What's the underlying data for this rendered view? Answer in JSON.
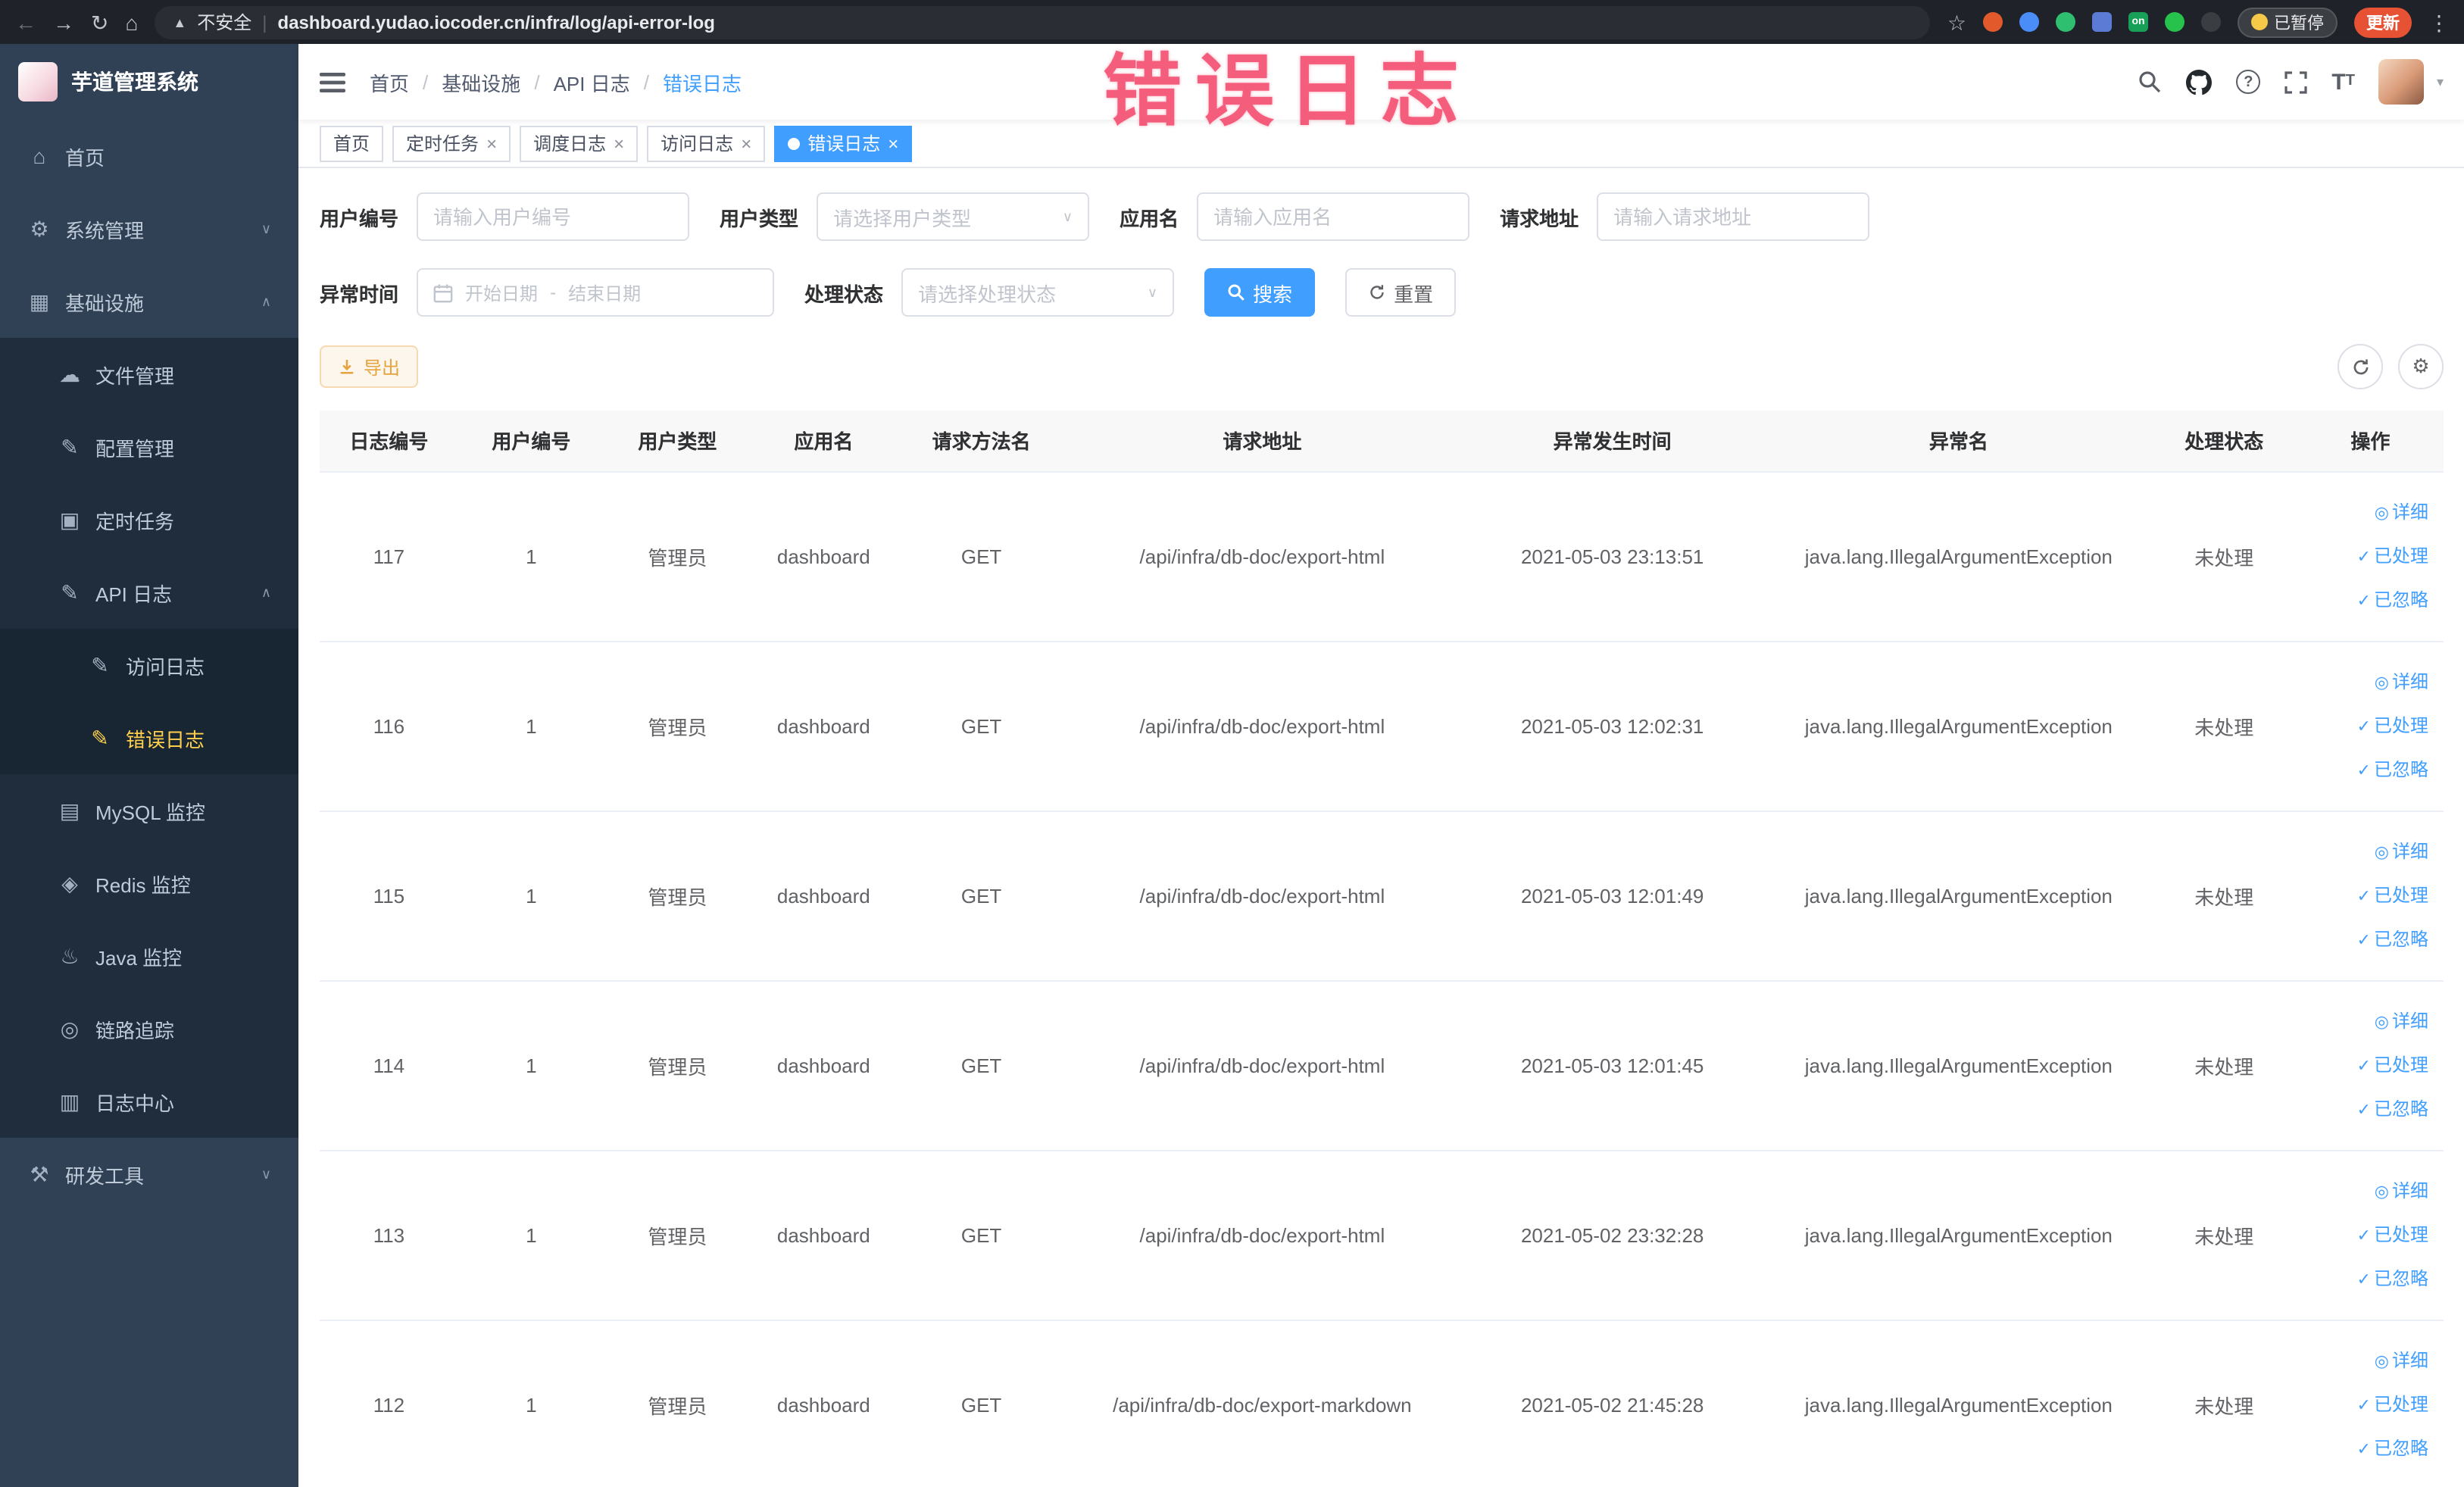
{
  "theme": {
    "accent": "#409eff",
    "sidebar_bg": "#304156",
    "sidebar_sub_bg": "#1f2d3d",
    "sidebar_active_text": "#ffd04b",
    "export_warning": "#e6a23c",
    "active_tag_bg": "#409eff",
    "annotation_color": "#f4476b",
    "update_button_color": "#e65233"
  },
  "browser": {
    "security_label": "不安全",
    "url": "dashboard.yudao.iocoder.cn/infra/log/api-error-log",
    "paused_label": "已暂停",
    "update_label": "更新"
  },
  "annotation": "错误日志",
  "sidebar": {
    "title": "芋道管理系统",
    "items": [
      {
        "label": "首页",
        "icon": "home-icon",
        "glyph": "⌂",
        "level": 1
      },
      {
        "label": "系统管理",
        "icon": "gear-icon",
        "glyph": "⚙",
        "level": 1,
        "chevron": "∨"
      },
      {
        "label": "基础设施",
        "icon": "grid-icon",
        "glyph": "▦",
        "level": 1,
        "chevron": "∧"
      },
      {
        "label": "文件管理",
        "icon": "cloud-icon",
        "glyph": "☁",
        "level": 2
      },
      {
        "label": "配置管理",
        "icon": "edit-icon",
        "glyph": "✎",
        "level": 2
      },
      {
        "label": "定时任务",
        "icon": "task-icon",
        "glyph": "▣",
        "level": 2
      },
      {
        "label": "API 日志",
        "icon": "log-icon",
        "glyph": "✎",
        "level": 2,
        "chevron": "∧"
      },
      {
        "label": "访问日志",
        "icon": "log-icon",
        "glyph": "✎",
        "level": 3
      },
      {
        "label": "错误日志",
        "icon": "log-icon",
        "glyph": "✎",
        "level": 3,
        "active": true
      },
      {
        "label": "MySQL 监控",
        "icon": "database-icon",
        "glyph": "▤",
        "level": 2
      },
      {
        "label": "Redis 监控",
        "icon": "redis-icon",
        "glyph": "◈",
        "level": 2
      },
      {
        "label": "Java 监控",
        "icon": "java-icon",
        "glyph": "♨",
        "level": 2
      },
      {
        "label": "链路追踪",
        "icon": "trace-eye-icon",
        "glyph": "◎",
        "level": 2
      },
      {
        "label": "日志中心",
        "icon": "log-center-icon",
        "glyph": "▥",
        "level": 2
      },
      {
        "label": "研发工具",
        "icon": "tools-icon",
        "glyph": "⚒",
        "level": 1,
        "chevron": "∨"
      }
    ]
  },
  "navbar": {
    "breadcrumb": [
      "首页",
      "基础设施",
      "API 日志",
      "错误日志"
    ]
  },
  "tabs": [
    {
      "label": "首页"
    },
    {
      "label": "定时任务",
      "closable": true
    },
    {
      "label": "调度日志",
      "closable": true
    },
    {
      "label": "访问日志",
      "closable": true
    },
    {
      "label": "错误日志",
      "closable": true,
      "active": true
    }
  ],
  "filters": {
    "user_id": {
      "label": "用户编号",
      "placeholder": "请输入用户编号"
    },
    "user_type": {
      "label": "用户类型",
      "placeholder": "请选择用户类型"
    },
    "app_name": {
      "label": "应用名",
      "placeholder": "请输入应用名"
    },
    "request_url": {
      "label": "请求地址",
      "placeholder": "请输入请求地址"
    },
    "exception_time": {
      "label": "异常时间",
      "start_placeholder": "开始日期",
      "separator": "-",
      "end_placeholder": "结束日期"
    },
    "process_status": {
      "label": "处理状态",
      "placeholder": "请选择处理状态"
    },
    "search_button": "搜索",
    "reset_button": "重置"
  },
  "toolbar": {
    "export_button": "导出"
  },
  "table": {
    "columns": [
      "日志编号",
      "用户编号",
      "用户类型",
      "应用名",
      "请求方法名",
      "请求地址",
      "异常发生时间",
      "异常名",
      "处理状态",
      "操作"
    ],
    "actions": [
      "详细",
      "已处理",
      "已忽略"
    ],
    "action_icons": [
      "eye-icon",
      "check-icon",
      "check-icon"
    ],
    "rows": [
      {
        "id": "117",
        "user_id": "1",
        "user_type": "管理员",
        "app_name": "dashboard",
        "method": "GET",
        "url": "/api/infra/db-doc/export-html",
        "time": "2021-05-03 23:13:51",
        "exception": "java.lang.IllegalArgumentException",
        "status": "未处理"
      },
      {
        "id": "116",
        "user_id": "1",
        "user_type": "管理员",
        "app_name": "dashboard",
        "method": "GET",
        "url": "/api/infra/db-doc/export-html",
        "time": "2021-05-03 12:02:31",
        "exception": "java.lang.IllegalArgumentException",
        "status": "未处理"
      },
      {
        "id": "115",
        "user_id": "1",
        "user_type": "管理员",
        "app_name": "dashboard",
        "method": "GET",
        "url": "/api/infra/db-doc/export-html",
        "time": "2021-05-03 12:01:49",
        "exception": "java.lang.IllegalArgumentException",
        "status": "未处理"
      },
      {
        "id": "114",
        "user_id": "1",
        "user_type": "管理员",
        "app_name": "dashboard",
        "method": "GET",
        "url": "/api/infra/db-doc/export-html",
        "time": "2021-05-03 12:01:45",
        "exception": "java.lang.IllegalArgumentException",
        "status": "未处理"
      },
      {
        "id": "113",
        "user_id": "1",
        "user_type": "管理员",
        "app_name": "dashboard",
        "method": "GET",
        "url": "/api/infra/db-doc/export-html",
        "time": "2021-05-02 23:32:28",
        "exception": "java.lang.IllegalArgumentException",
        "status": "未处理"
      },
      {
        "id": "112",
        "user_id": "1",
        "user_type": "管理员",
        "app_name": "dashboard",
        "method": "GET",
        "url": "/api/infra/db-doc/export-markdown",
        "time": "2021-05-02 21:45:28",
        "exception": "java.lang.IllegalArgumentException",
        "status": "未处理"
      }
    ]
  }
}
